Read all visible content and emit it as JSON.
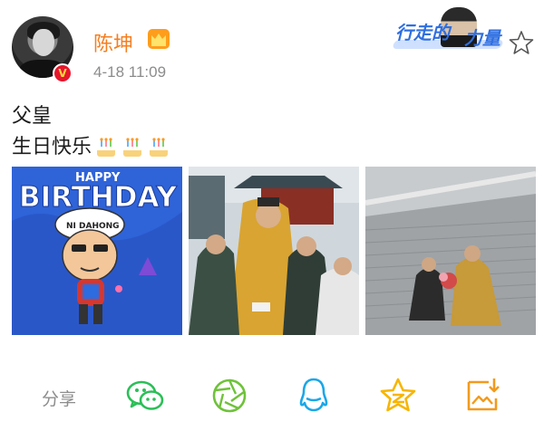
{
  "post": {
    "username": "陈坤",
    "timestamp": "4-18 11:09",
    "text_line1": "父皇",
    "text_line2": "生日快乐",
    "badge": "V"
  },
  "banner": {
    "text_part1": "行走的",
    "text_part2": "力量"
  },
  "images": [
    {
      "name": "birthday-cartoon",
      "caption_top": "HAPPY",
      "caption_main": "BIRTHDAY",
      "cap_text": "NI DAHONG"
    },
    {
      "name": "emperor-group-photo"
    },
    {
      "name": "palace-stairs-photo"
    }
  ],
  "share_bar": {
    "label": "分享",
    "icons": [
      "wechat-icon",
      "moments-icon",
      "qq-icon",
      "qzone-icon",
      "save-image-icon"
    ]
  },
  "colors": {
    "username": "#f57e1f",
    "timestamp": "#8c8c8c",
    "wechat": "#2bbf57",
    "moments": "#6fc23a",
    "qq": "#1aa7e8",
    "qzone": "#f7b500",
    "save": "#f29a1d"
  }
}
